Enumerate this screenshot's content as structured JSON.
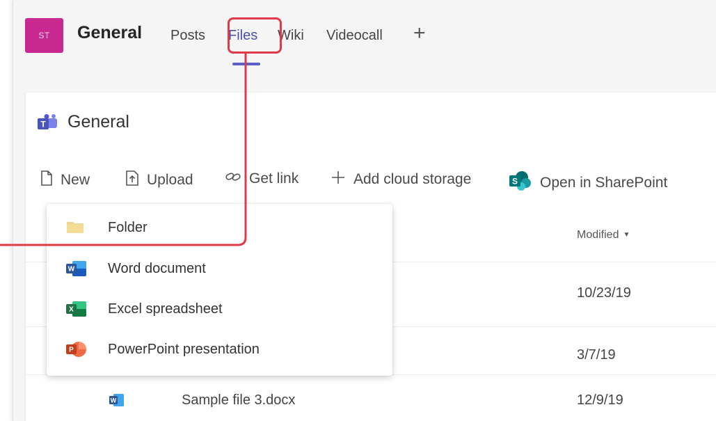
{
  "header": {
    "avatar_initials": "ST",
    "channel_title": "General",
    "tabs": [
      {
        "label": "Posts"
      },
      {
        "label": "Files"
      },
      {
        "label": "Wiki"
      },
      {
        "label": "Videocall"
      }
    ],
    "add_tab_label": "+"
  },
  "panel": {
    "title": "General",
    "toolbar": {
      "new_label": "New",
      "upload_label": "Upload",
      "get_link_label": "Get link",
      "add_cloud_label": "Add cloud storage",
      "open_sharepoint_label": "Open in SharePoint"
    },
    "columns": {
      "modified": "Modified"
    },
    "rows": [
      {
        "name": "",
        "modified": "10/23/19"
      },
      {
        "name": "",
        "modified": "3/7/19"
      },
      {
        "name": "Sample file 3.docx",
        "modified": "12/9/19"
      }
    ]
  },
  "new_menu": {
    "items": [
      {
        "label": "Folder",
        "icon": "folder-icon"
      },
      {
        "label": "Word document",
        "icon": "word-icon"
      },
      {
        "label": "Excel spreadsheet",
        "icon": "excel-icon"
      },
      {
        "label": "PowerPoint presentation",
        "icon": "powerpoint-icon"
      }
    ]
  },
  "colors": {
    "accent": "#5b5fc7",
    "avatar": "#c8288f",
    "callout": "#e03a48",
    "word": "#2b579a",
    "excel": "#217346",
    "powerpoint": "#d24726",
    "folder": "#f1d58b"
  }
}
